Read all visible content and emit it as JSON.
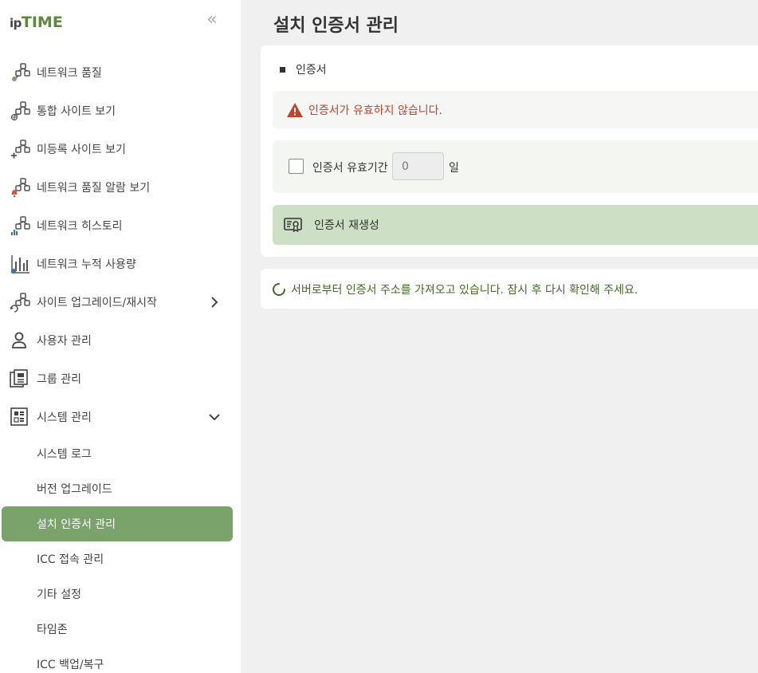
{
  "logo": {
    "ip": "ip",
    "time": "TIME"
  },
  "sidebar": {
    "collapse": "«",
    "items": [
      {
        "label": "네트워크 품질",
        "icon": "network-quality-icon"
      },
      {
        "label": "통합 사이트 보기",
        "icon": "integrated-site-icon"
      },
      {
        "label": "미등록 사이트 보기",
        "icon": "unregistered-site-icon"
      },
      {
        "label": "네트워크 품질 알람 보기",
        "icon": "alarm-icon"
      },
      {
        "label": "네트워크 히스토리",
        "icon": "history-icon"
      },
      {
        "label": "네트워크 누적 사용량",
        "icon": "usage-icon"
      },
      {
        "label": "사이트 업그레이드/재시작",
        "icon": "upgrade-icon"
      },
      {
        "label": "사용자 관리",
        "icon": "user-icon"
      },
      {
        "label": "그룹 관리",
        "icon": "group-icon"
      },
      {
        "label": "시스템 관리",
        "icon": "system-icon"
      }
    ],
    "subitems": [
      {
        "label": "시스템 로그"
      },
      {
        "label": "버전 업그레이드"
      },
      {
        "label": "설치 인증서 관리"
      },
      {
        "label": "ICC 접속 관리"
      },
      {
        "label": "기타 설정"
      },
      {
        "label": "타임존"
      },
      {
        "label": "ICC 백업/복구"
      }
    ]
  },
  "page": {
    "title": "설치 인증서 관리"
  },
  "certificate": {
    "section_title": "인증서",
    "alert": "인증서가 유효하지 않습니다.",
    "validity_label": "인증서 유효기간",
    "validity_value": "0",
    "validity_placeholder": "0",
    "validity_unit": "일",
    "regenerate_label": "인증서 재생성"
  },
  "status": {
    "loading_text": "서버로부터 인증서 주소를 가져오고 있습니다. 잠시 후 다시 확인해 주세요."
  },
  "colors": {
    "accent": "#7aa36c",
    "error": "#c0442d",
    "brand": "#5d8a3a"
  }
}
